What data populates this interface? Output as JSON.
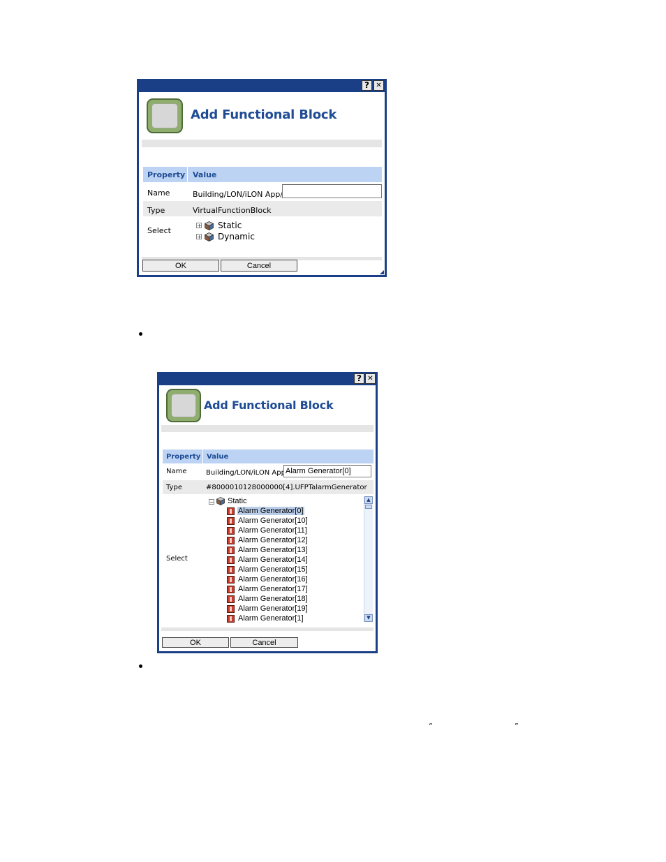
{
  "dialog1": {
    "help": "?",
    "close": "✕",
    "title": "Add Functional Block",
    "col_property": "Property",
    "col_value": "Value",
    "name_label": "Name",
    "name_prefix": "Building/LON/iLON App/",
    "name_value": "",
    "type_label": "Type",
    "type_value": "VirtualFunctionBlock",
    "select_label": "Select",
    "tree": [
      {
        "toggle": "+",
        "label": "Static"
      },
      {
        "toggle": "+",
        "label": "Dynamic"
      }
    ],
    "ok": "OK",
    "cancel": "Cancel"
  },
  "dialog2": {
    "help": "?",
    "close": "✕",
    "title": "Add Functional Block",
    "col_property": "Property",
    "col_value": "Value",
    "name_label": "Name",
    "name_prefix": "Building/LON/iLON App/",
    "name_value": "Alarm Generator[0]",
    "type_label": "Type",
    "type_value": "#8000010128000000[4].UFPTalarmGenerator",
    "select_label": "Select",
    "root": {
      "toggle": "−",
      "label": "Static"
    },
    "items": [
      "Alarm Generator[0]",
      "Alarm Generator[10]",
      "Alarm Generator[11]",
      "Alarm Generator[12]",
      "Alarm Generator[13]",
      "Alarm Generator[14]",
      "Alarm Generator[15]",
      "Alarm Generator[16]",
      "Alarm Generator[17]",
      "Alarm Generator[18]",
      "Alarm Generator[19]",
      "Alarm Generator[1]"
    ],
    "selected_index": 0,
    "ok": "OK",
    "cancel": "Cancel"
  },
  "page": {
    "open_quote": "“",
    "close_quote": "”"
  }
}
